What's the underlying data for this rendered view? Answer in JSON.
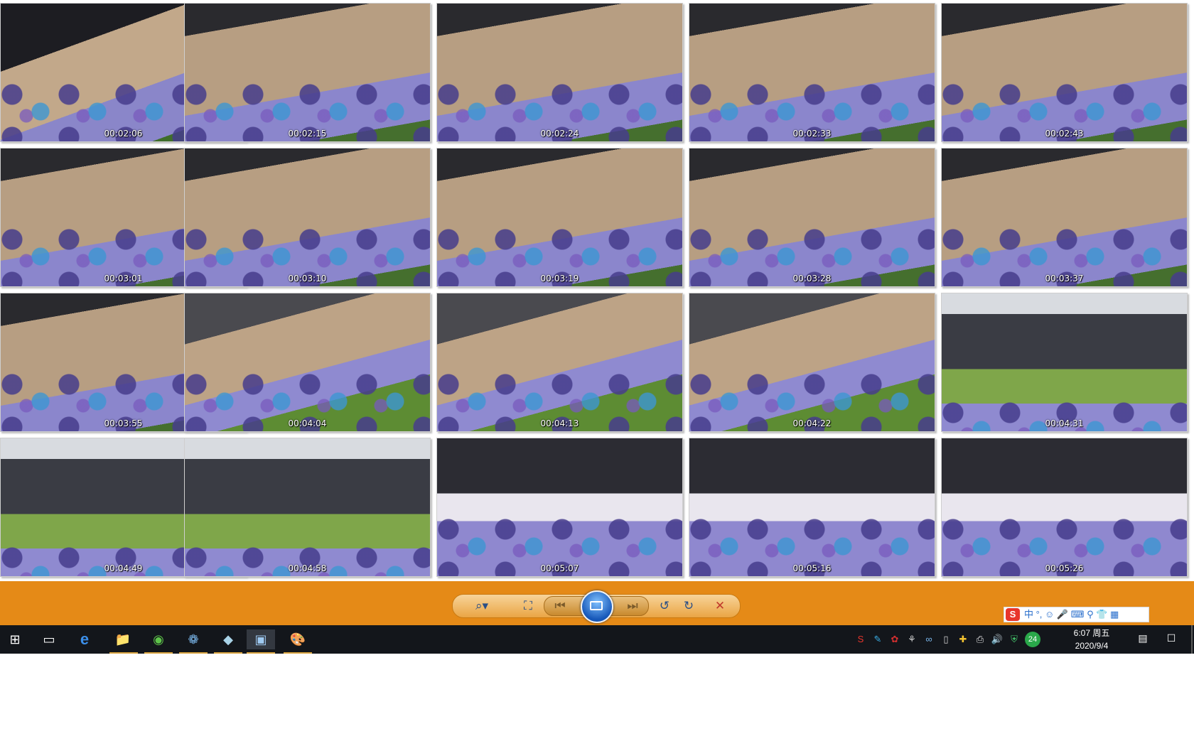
{
  "thumbnails": [
    {
      "time": "00:02:06",
      "scene": "feet-grass"
    },
    {
      "time": "00:02:15",
      "scene": "foot-closeup"
    },
    {
      "time": "00:02:24",
      "scene": "foot-closeup"
    },
    {
      "time": "00:02:33",
      "scene": "foot-closeup"
    },
    {
      "time": "00:02:43",
      "scene": "foot-closeup"
    },
    {
      "time": "00:03:01",
      "scene": "foot-closeup"
    },
    {
      "time": "00:03:10",
      "scene": "foot-closeup"
    },
    {
      "time": "00:03:19",
      "scene": "foot-closeup"
    },
    {
      "time": "00:03:28",
      "scene": "foot-closeup"
    },
    {
      "time": "00:03:37",
      "scene": "foot-closeup"
    },
    {
      "time": "00:03:55",
      "scene": "foot-closeup"
    },
    {
      "time": "00:04:04",
      "scene": "foot-grass"
    },
    {
      "time": "00:04:13",
      "scene": "foot-grass"
    },
    {
      "time": "00:04:22",
      "scene": "foot-grass"
    },
    {
      "time": "00:04:31",
      "scene": "people-grass"
    },
    {
      "time": "00:04:49",
      "scene": "people-grass"
    },
    {
      "time": "00:04:58",
      "scene": "people-grass"
    },
    {
      "time": "00:05:07",
      "scene": "picnic-mat"
    },
    {
      "time": "00:05:16",
      "scene": "picnic-mat"
    },
    {
      "time": "00:05:26",
      "scene": "picnic-mat"
    }
  ],
  "viewer_toolbar": {
    "icons": [
      "zoom-icon",
      "fit-icon",
      "previous-icon",
      "slideshow-icon",
      "next-icon",
      "rotate-left-icon",
      "rotate-right-icon",
      "delete-icon"
    ],
    "zoom_glyph": "⌕▾",
    "fit_glyph": "⛶",
    "prev_glyph": "⏮",
    "next_glyph": "⏭",
    "rotate_left_glyph": "↺",
    "rotate_right_glyph": "↻",
    "delete_glyph": "✕"
  },
  "ime": {
    "logo": "S",
    "items": "中 °, ☺ 🎤 ⌨ ⚲ 👕 ▦"
  },
  "taskbar": {
    "start_glyph": "⊞",
    "task_view_glyph": "▭",
    "ie_glyph": "e",
    "explorer_glyph": "📁",
    "app3_glyph": "◉",
    "app4_glyph": "❁",
    "app5_glyph": "◆",
    "photos_glyph": "▣",
    "paint_glyph": "🎨",
    "tray_icons": [
      "S",
      "✎",
      "✿",
      "⚘",
      "∞",
      "▯",
      "✚",
      "⎙",
      "🔊",
      "⛨",
      "24"
    ],
    "clock_time": "6:07 周五",
    "clock_date": "2020/9/4",
    "notes_glyph": "▤",
    "action_center_glyph": "☐"
  },
  "colors": {
    "control_bar": "#e58a17",
    "taskbar": "#13161b",
    "slideshow_blue": "#1657b8"
  }
}
